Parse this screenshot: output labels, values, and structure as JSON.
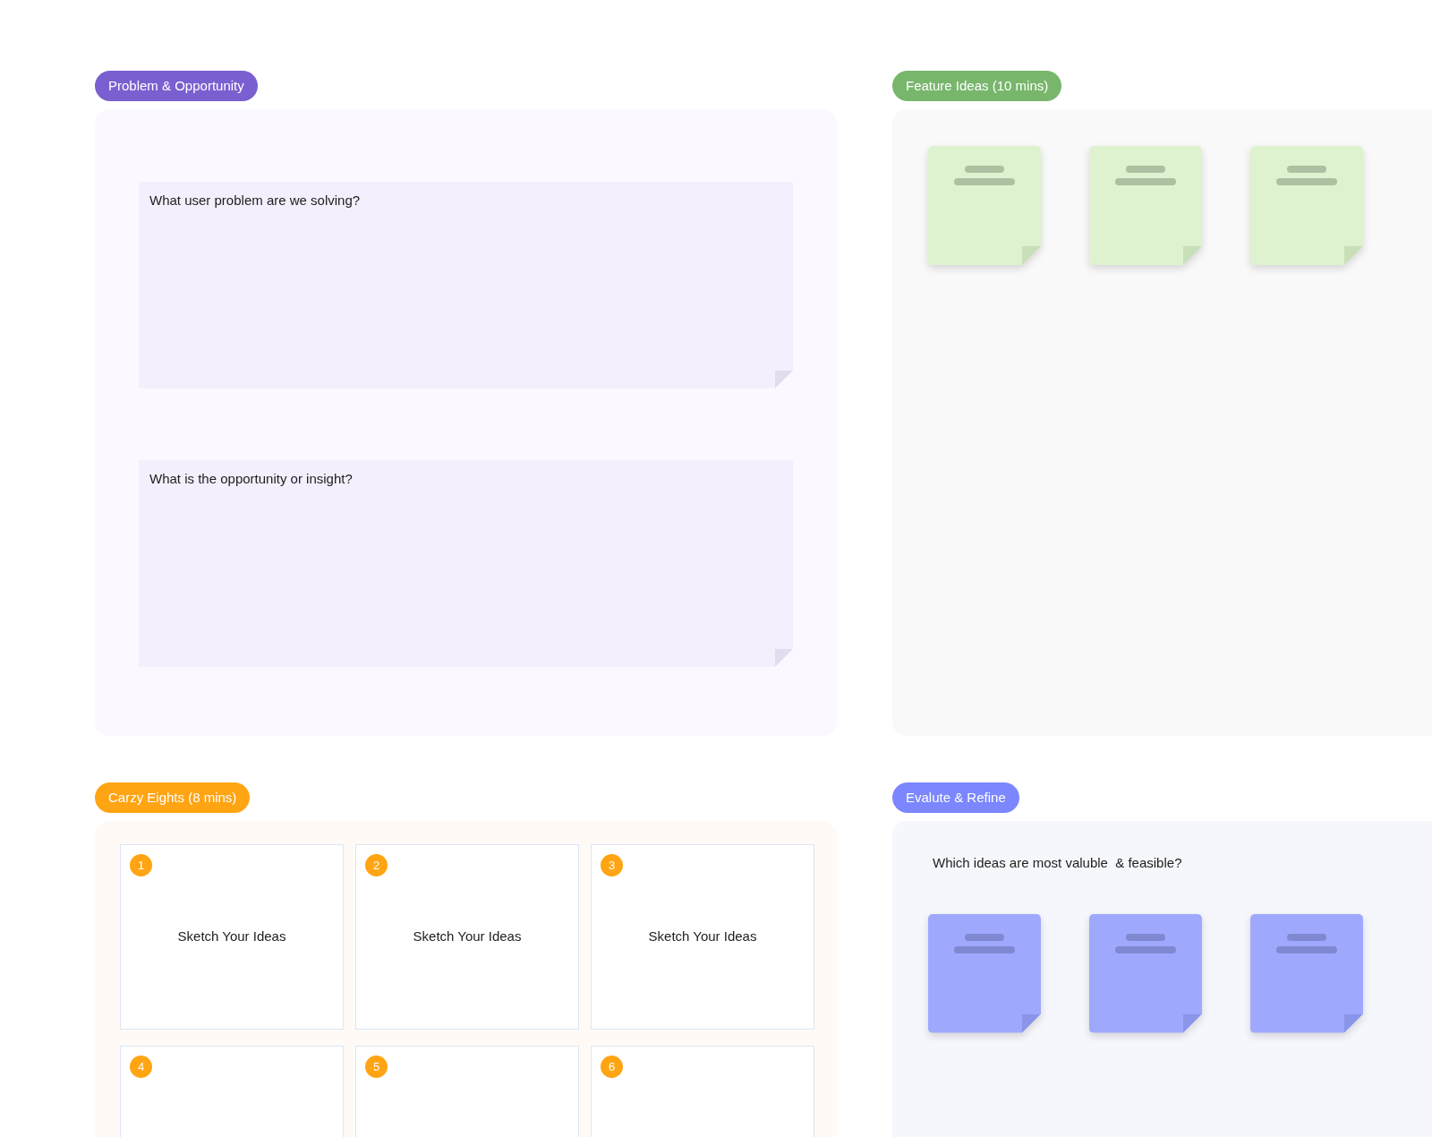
{
  "sections": [
    {
      "kind": "prompts",
      "title": "Problem & Opportunity",
      "color": "#7a5fd0",
      "prompts": [
        "What user problem are we solving?",
        "What is the opportunity or insight?"
      ]
    },
    {
      "kind": "notes",
      "title": "Feature Ideas (10 mins)",
      "color": "#78b66c",
      "notes": [
        {
          "kind": "blank"
        },
        {
          "kind": "blank"
        },
        {
          "kind": "blank"
        }
      ]
    },
    {
      "kind": "sketches",
      "title": "Carzy Eights (8 mins)",
      "color": "#ffa412",
      "frames": [
        {
          "number": "1",
          "label": "Sketch Your Ideas"
        },
        {
          "number": "2",
          "label": "Sketch Your Ideas"
        },
        {
          "number": "3",
          "label": "Sketch Your Ideas"
        },
        {
          "number": "4"
        },
        {
          "number": "5"
        },
        {
          "number": "6"
        }
      ]
    },
    {
      "kind": "evaluate",
      "title": "Evalute & Refine",
      "color": "#7b86ff",
      "question": "Which ideas are most valuble  & feasible?",
      "notes": [
        {
          "kind": "blank"
        },
        {
          "kind": "blank"
        },
        {
          "kind": "blank"
        }
      ]
    }
  ]
}
